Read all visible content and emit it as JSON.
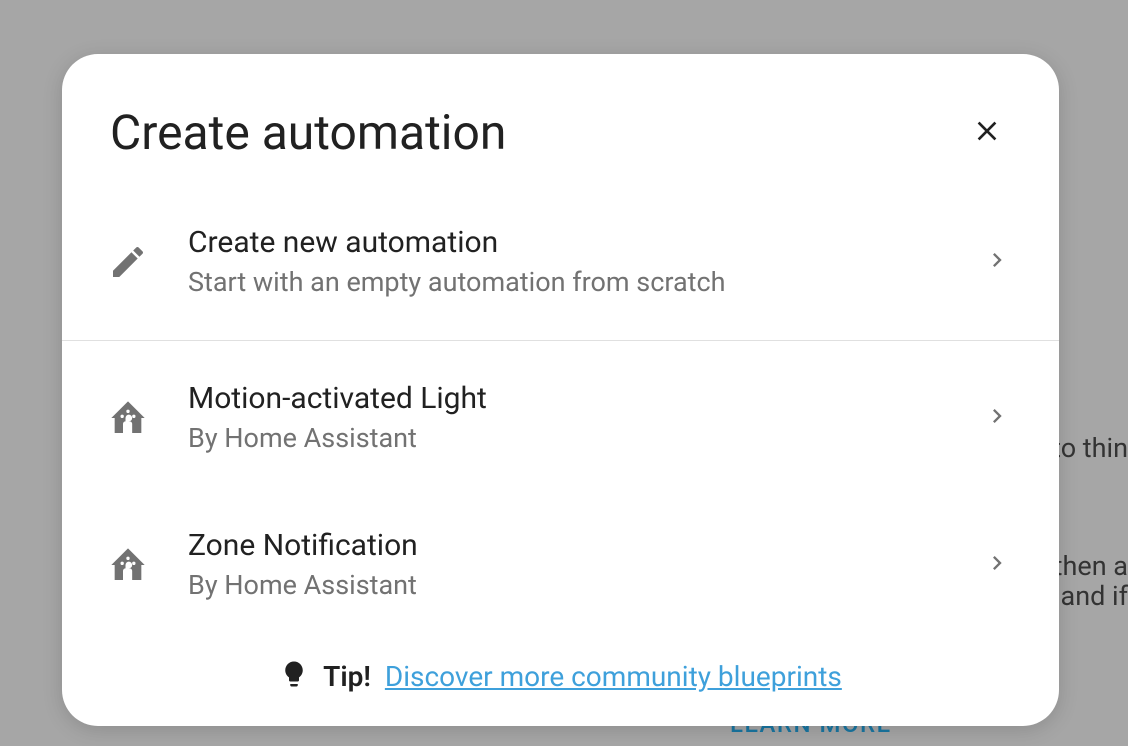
{
  "background": {
    "text1": "to thin",
    "text2": "then a",
    "text3": "and if",
    "learn_more": "LEARN MORE"
  },
  "dialog": {
    "title": "Create automation",
    "items": [
      {
        "title": "Create new automation",
        "subtitle": "Start with an empty automation from scratch"
      },
      {
        "title": "Motion-activated Light",
        "subtitle": "By Home Assistant"
      },
      {
        "title": "Zone Notification",
        "subtitle": "By Home Assistant"
      }
    ],
    "tip": {
      "label": "Tip!",
      "link_text": "Discover more community blueprints"
    }
  }
}
